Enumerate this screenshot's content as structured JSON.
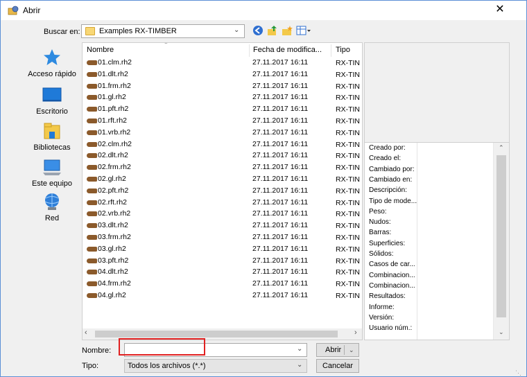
{
  "window": {
    "title": "Abrir",
    "close_glyph": "✕"
  },
  "toolbar": {
    "lookin_label": "Buscar en:",
    "lookin_value": "Examples RX-TIMBER",
    "icons": [
      "back-icon",
      "up-folder-icon",
      "new-folder-icon",
      "view-menu-icon"
    ]
  },
  "places": [
    {
      "label": "Acceso rápido",
      "icon": "star-icon"
    },
    {
      "label": "Escritorio",
      "icon": "desktop-icon"
    },
    {
      "label": "Bibliotecas",
      "icon": "library-icon"
    },
    {
      "label": "Este equipo",
      "icon": "computer-icon"
    },
    {
      "label": "Red",
      "icon": "network-icon"
    }
  ],
  "columns": {
    "name": "Nombre",
    "date": "Fecha de modifica...",
    "type": "Tipo"
  },
  "files": [
    {
      "name": "01.clm.rh2",
      "date": "27.11.2017 16:11",
      "type": "RX-TIN"
    },
    {
      "name": "01.dlt.rh2",
      "date": "27.11.2017 16:11",
      "type": "RX-TIN"
    },
    {
      "name": "01.frm.rh2",
      "date": "27.11.2017 16:11",
      "type": "RX-TIN"
    },
    {
      "name": "01.gl.rh2",
      "date": "27.11.2017 16:11",
      "type": "RX-TIN"
    },
    {
      "name": "01.pft.rh2",
      "date": "27.11.2017 16:11",
      "type": "RX-TIN"
    },
    {
      "name": "01.rft.rh2",
      "date": "27.11.2017 16:11",
      "type": "RX-TIN"
    },
    {
      "name": "01.vrb.rh2",
      "date": "27.11.2017 16:11",
      "type": "RX-TIN"
    },
    {
      "name": "02.clm.rh2",
      "date": "27.11.2017 16:11",
      "type": "RX-TIN"
    },
    {
      "name": "02.dlt.rh2",
      "date": "27.11.2017 16:11",
      "type": "RX-TIN"
    },
    {
      "name": "02.frm.rh2",
      "date": "27.11.2017 16:11",
      "type": "RX-TIN"
    },
    {
      "name": "02.gl.rh2",
      "date": "27.11.2017 16:11",
      "type": "RX-TIN"
    },
    {
      "name": "02.pft.rh2",
      "date": "27.11.2017 16:11",
      "type": "RX-TIN"
    },
    {
      "name": "02.rft.rh2",
      "date": "27.11.2017 16:11",
      "type": "RX-TIN"
    },
    {
      "name": "02.vrb.rh2",
      "date": "27.11.2017 16:11",
      "type": "RX-TIN"
    },
    {
      "name": "03.dlt.rh2",
      "date": "27.11.2017 16:11",
      "type": "RX-TIN"
    },
    {
      "name": "03.frm.rh2",
      "date": "27.11.2017 16:11",
      "type": "RX-TIN"
    },
    {
      "name": "03.gl.rh2",
      "date": "27.11.2017 16:11",
      "type": "RX-TIN"
    },
    {
      "name": "03.pft.rh2",
      "date": "27.11.2017 16:11",
      "type": "RX-TIN"
    },
    {
      "name": "04.dlt.rh2",
      "date": "27.11.2017 16:11",
      "type": "RX-TIN"
    },
    {
      "name": "04.frm.rh2",
      "date": "27.11.2017 16:11",
      "type": "RX-TIN"
    },
    {
      "name": "04.gl.rh2",
      "date": "27.11.2017 16:11",
      "type": "RX-TIN"
    }
  ],
  "properties": [
    "Creado por:",
    "Creado el:",
    "Cambiado por:",
    "Cambiado en:",
    "Descripción:",
    "Tipo de mode...",
    "Peso:",
    "Nudos:",
    "Barras:",
    "Superficies:",
    "Sólidos:",
    "Casos de car...",
    "Combinacion...",
    "Combinacion...",
    "Resultados:",
    "Informe:",
    "Versión:",
    "Usuario núm.:"
  ],
  "bottom": {
    "name_label": "Nombre:",
    "name_value": "",
    "type_label": "Tipo:",
    "type_value": "Todos los archivos (*.*)",
    "open_label": "Abrir",
    "cancel_label": "Cancelar"
  },
  "colors": {
    "highlight": "#e02020",
    "frame": "#5b8fd6"
  }
}
